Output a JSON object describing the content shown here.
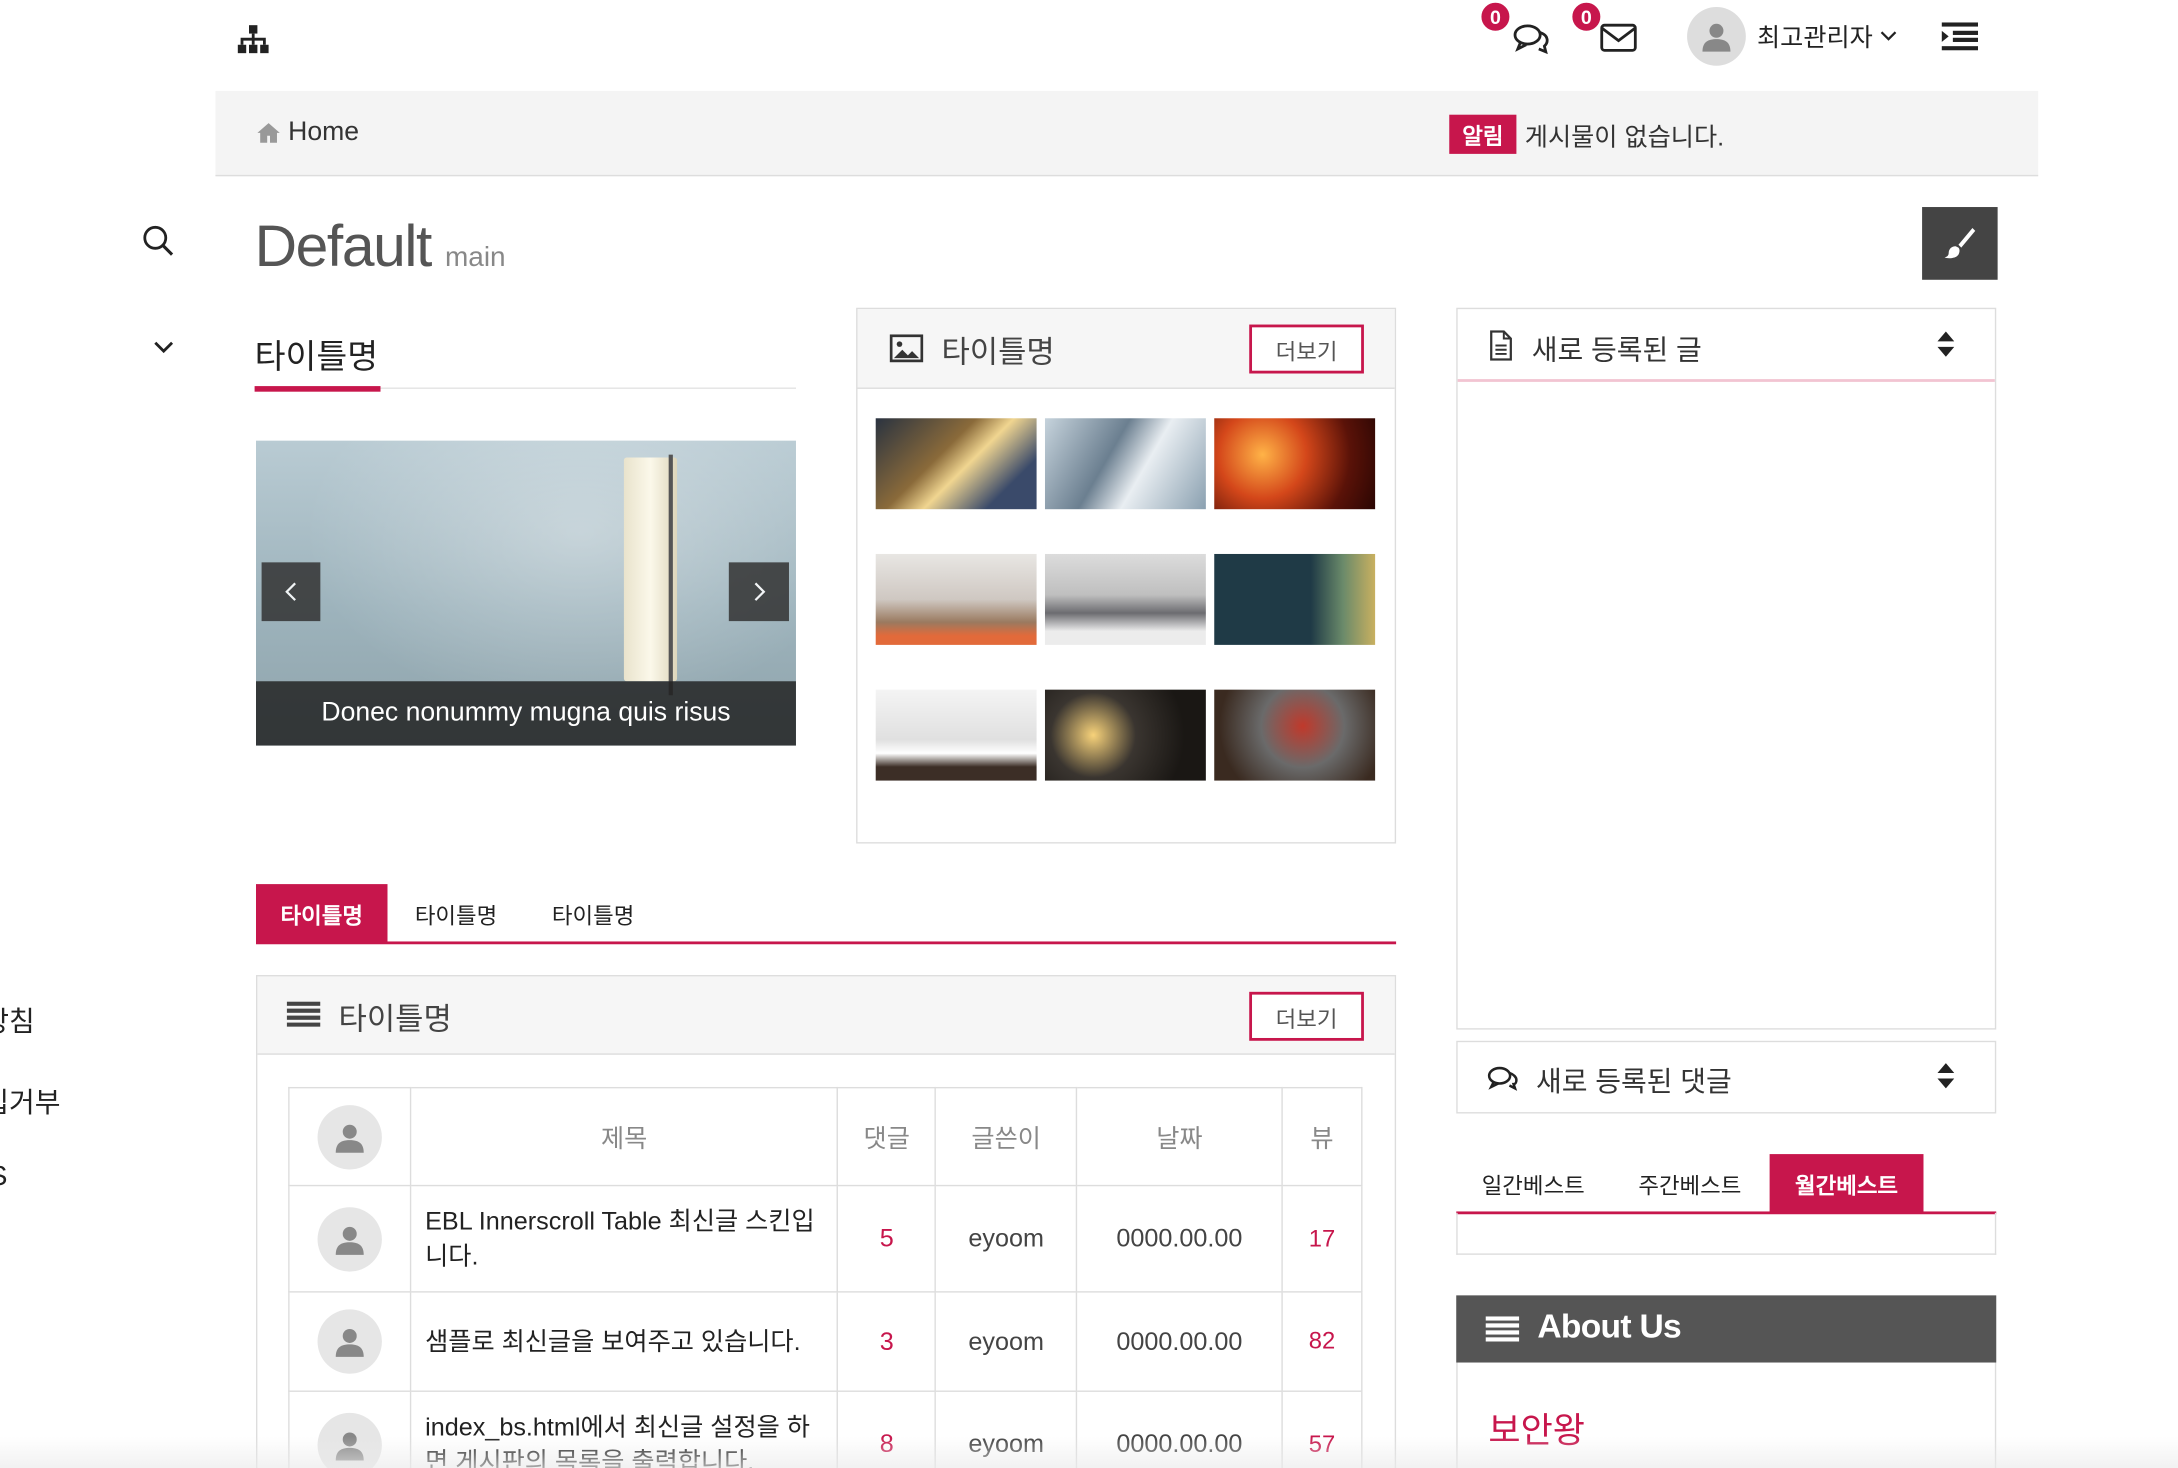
{
  "header": {
    "chat_count": "0",
    "mail_count": "0",
    "user_name": "최고관리자"
  },
  "breadcrumb": {
    "home_label": "Home",
    "notice_badge": "알림",
    "notice_text": "게시물이 없습니다."
  },
  "page": {
    "title": "Default",
    "subtitle": "main"
  },
  "sidebar": {
    "items": [
      "방침",
      "집거부",
      "S"
    ]
  },
  "slider": {
    "section_title": "타이틀명",
    "caption": "Donec nonummy mugna quis risus"
  },
  "gallery": {
    "title": "타이틀명",
    "more_label": "더보기"
  },
  "tabs": [
    "타이틀명",
    "타이틀명",
    "타이틀명"
  ],
  "latest": {
    "title": "타이틀명",
    "more_label": "더보기",
    "columns": [
      "제목",
      "댓글",
      "글쓴이",
      "날짜",
      "뷰"
    ],
    "rows": [
      {
        "title": "EBL Innerscroll Table 최신글 스킨입니다.",
        "comments": "5",
        "author": "eyoom",
        "date": "0000.00.00",
        "views": "17"
      },
      {
        "title": "샘플로 최신글을 보여주고 있습니다.",
        "comments": "3",
        "author": "eyoom",
        "date": "0000.00.00",
        "views": "82"
      },
      {
        "title": "index_bs.html에서 최신글 설정을 하면 게시판의 목록을 출력합니다.",
        "comments": "8",
        "author": "eyoom",
        "date": "0000.00.00",
        "views": "57"
      }
    ]
  },
  "right": {
    "new_posts_title": "새로 등록된 글",
    "new_comments_title": "새로 등록된 댓글",
    "best_tabs": [
      "일간베스트",
      "주간베스트",
      "월간베스트"
    ],
    "about_title": "About Us",
    "about_heading": "보안왕"
  },
  "colors": {
    "accent": "#c7164c",
    "dark_header": "#555555"
  }
}
